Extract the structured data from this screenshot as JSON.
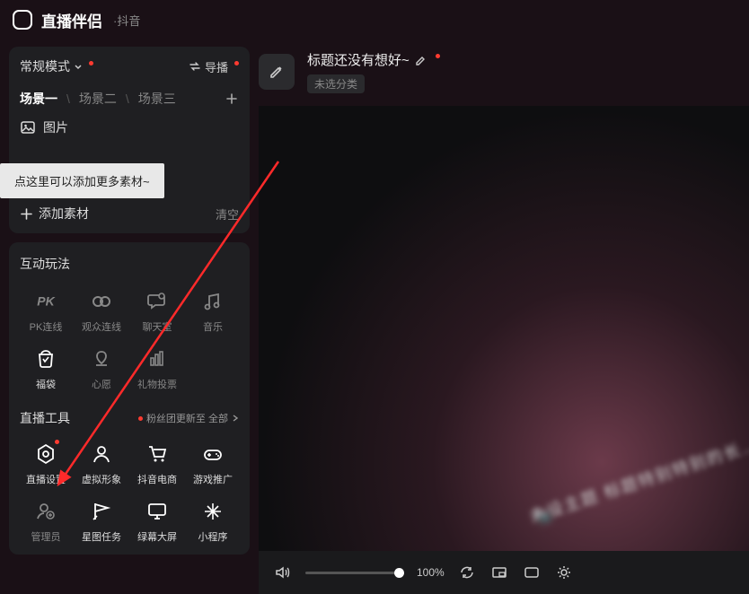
{
  "header": {
    "app_title": "直播伴侣",
    "app_sub": "·抖音"
  },
  "panel1": {
    "mode_label": "常规模式",
    "swap_label": "导播",
    "scenes": [
      "场景一",
      "场景二",
      "场景三"
    ],
    "asset_image": "图片",
    "tooltip": "点这里可以添加更多素材~",
    "add_asset": "添加素材",
    "clear": "清空"
  },
  "interact": {
    "title": "互动玩法",
    "items": [
      {
        "label": "PK连线"
      },
      {
        "label": "观众连线"
      },
      {
        "label": "聊天室"
      },
      {
        "label": "音乐"
      },
      {
        "label": "福袋"
      },
      {
        "label": "心愿"
      },
      {
        "label": "礼物投票"
      }
    ]
  },
  "tools": {
    "title": "直播工具",
    "fans_update": "粉丝团更新至 全部",
    "items": [
      {
        "label": "直播设置"
      },
      {
        "label": "虚拟形象"
      },
      {
        "label": "抖音电商"
      },
      {
        "label": "游戏推广"
      },
      {
        "label": "管理员"
      },
      {
        "label": "星图任务"
      },
      {
        "label": "绿幕大屏"
      },
      {
        "label": "小程序"
      }
    ]
  },
  "content": {
    "title": "标题还没有想好~",
    "category": "未选分类"
  },
  "bottom": {
    "volume_pct": "100%"
  }
}
